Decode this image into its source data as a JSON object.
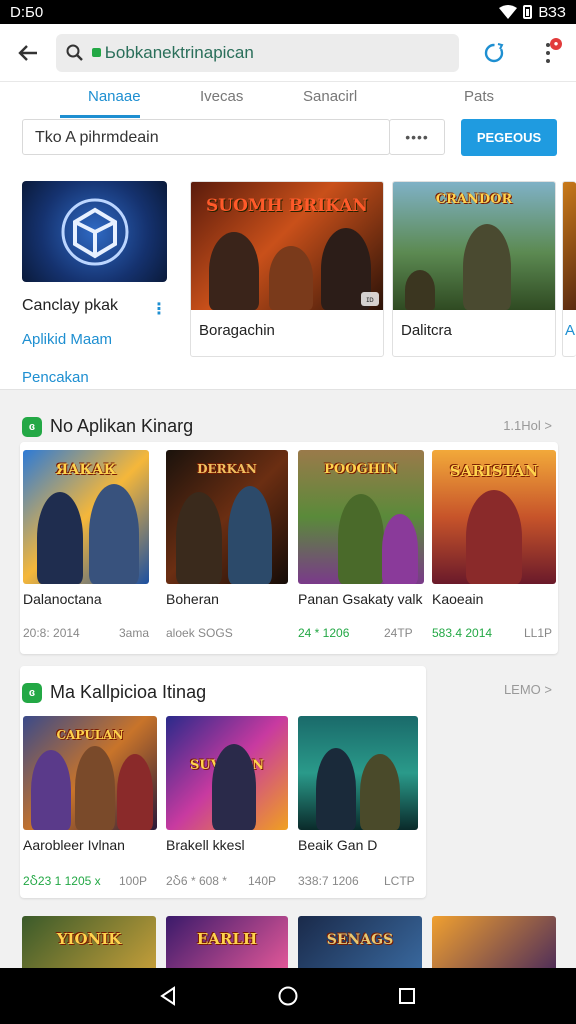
{
  "status": {
    "time": "D:Б0",
    "right_text": "ВЗЗ"
  },
  "appbar": {
    "search_text": "Ьоbkanektrinapican"
  },
  "tabs": [
    {
      "label": "Nanaae",
      "active": true
    },
    {
      "label": "Ivecas",
      "active": false
    },
    {
      "label": "Sanacirl",
      "active": false
    },
    {
      "label": "Pats",
      "active": false
    }
  ],
  "filter": {
    "input_value": "Tko A pihrmdeain",
    "more_label": "••••",
    "button_label": "PEGEOUS"
  },
  "featured": {
    "first": {
      "name": "Canclay pkak",
      "links": [
        "Aplikid Maam",
        "Pencakan"
      ]
    },
    "cards": [
      {
        "title": "SUOMH BRIKAN",
        "label": "Boragachin",
        "chip": "ɪᴅ"
      },
      {
        "title": "CRANDOR",
        "label": "Dalitcra",
        "chip": ""
      },
      {
        "title": "",
        "label": "A",
        "chip": ""
      }
    ]
  },
  "section1": {
    "icon": "ɞ",
    "title": "No Aplikan Kinarg",
    "more": "1.1Hol >",
    "apps": [
      {
        "title": "ЯАКАК",
        "name": "Dalanoctana",
        "meta_a": "20:8: 2014",
        "meta_b": "3ama"
      },
      {
        "title": "DERKAN",
        "name": "Boheran",
        "meta_a": "aloek SOGS",
        "meta_b": ""
      },
      {
        "title": "POOGHIN",
        "name": "Panan Gsakaty valk",
        "meta_a": "24 * 1206",
        "meta_b": "24TP"
      },
      {
        "title": "SARISTAN",
        "name": "Kaoeain",
        "meta_a": "583.4 2014",
        "meta_b": "LL1P"
      }
    ]
  },
  "section2": {
    "icon": "ɞ",
    "title": "Ma Kallpicioa Itinag",
    "more": "LEMO >",
    "apps": [
      {
        "title": "CAPULAN",
        "name": "Aarobleer Ivlnan",
        "meta_a": "2Ⴢ23 1 1205 x",
        "meta_b": "100P"
      },
      {
        "title": "SUVAHEN",
        "name": "Brakell kkesl",
        "meta_a": "2Ⴢ6 * 608 *",
        "meta_b": "140P"
      },
      {
        "title": "",
        "name": "Beaik Gan D",
        "meta_a": "3З8:7 1206",
        "meta_b": "LCTP"
      }
    ]
  },
  "bottom_row": [
    {
      "title": "YIONIK"
    },
    {
      "title": "EARLH"
    },
    {
      "title": "SENAGS"
    },
    {
      "title": ""
    }
  ],
  "colors": {
    "accent": "#1f9be0",
    "green": "#23a845",
    "red": "#e23b3b"
  },
  "icons": [
    "back-arrow-icon",
    "search-icon",
    "sync-icon",
    "more-vert-icon",
    "nav-back-icon",
    "nav-home-icon",
    "nav-recents-icon"
  ]
}
